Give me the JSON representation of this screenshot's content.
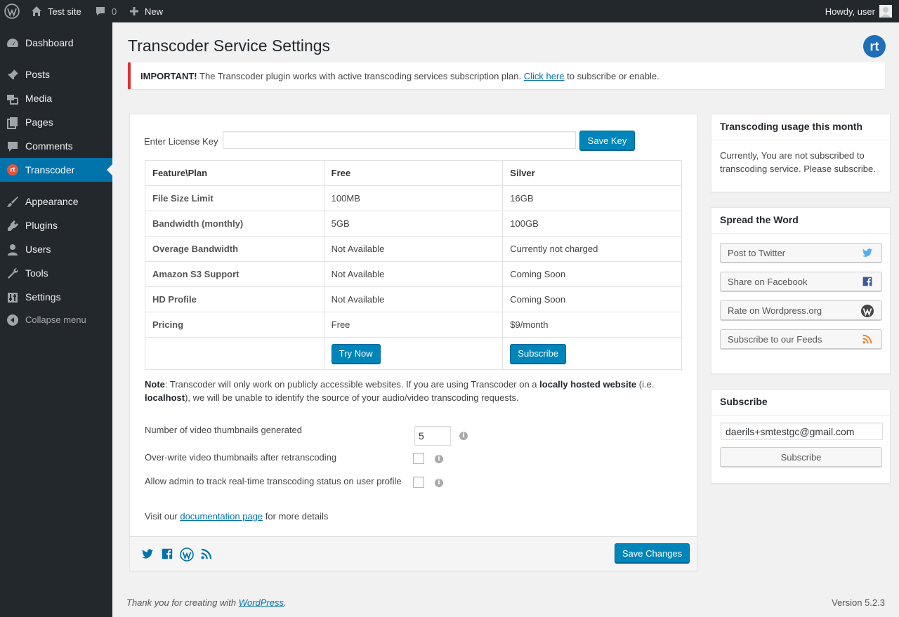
{
  "adminbar": {
    "site_name": "Test site",
    "comments_count": "0",
    "new_label": "New",
    "howdy": "Howdy, user"
  },
  "sidebar": {
    "items": [
      {
        "label": "Dashboard",
        "icon": "dashboard-icon"
      },
      {
        "label": "Posts",
        "icon": "pin-icon"
      },
      {
        "label": "Media",
        "icon": "media-icon"
      },
      {
        "label": "Pages",
        "icon": "pages-icon"
      },
      {
        "label": "Comments",
        "icon": "comment-icon"
      },
      {
        "label": "Transcoder",
        "icon": "rt-icon",
        "current": true
      },
      {
        "label": "Appearance",
        "icon": "brush-icon"
      },
      {
        "label": "Plugins",
        "icon": "plug-icon"
      },
      {
        "label": "Users",
        "icon": "user-icon"
      },
      {
        "label": "Tools",
        "icon": "wrench-icon"
      },
      {
        "label": "Settings",
        "icon": "settings-icon"
      },
      {
        "label": "Collapse menu",
        "icon": "collapse-icon"
      }
    ]
  },
  "page": {
    "title": "Transcoder Service Settings",
    "logo_text": "rt"
  },
  "notice": {
    "strong": "IMPORTANT!",
    "text": " The Transcoder plugin works with active transcoding services subscription plan. ",
    "link": "Click here",
    "after": " to subscribe or enable."
  },
  "license": {
    "label": "Enter License Key",
    "value": "",
    "button": "Save Key"
  },
  "plans": {
    "headers": [
      "Feature\\Plan",
      "Free",
      "Silver"
    ],
    "rows": [
      [
        "File Size Limit",
        "100MB",
        "16GB"
      ],
      [
        "Bandwidth (monthly)",
        "5GB",
        "100GB"
      ],
      [
        "Overage Bandwidth",
        "Not Available",
        "Currently not charged"
      ],
      [
        "Amazon S3 Support",
        "Not Available",
        "Coming Soon"
      ],
      [
        "HD Profile",
        "Not Available",
        "Coming Soon"
      ],
      [
        "Pricing",
        "Free",
        "$9/month"
      ]
    ],
    "try_button": "Try Now",
    "subscribe_button": "Subscribe"
  },
  "note": {
    "label": "Note",
    "t1": ": Transcoder will only work on publicly accessible websites. If you are using Transcoder on a ",
    "b1": "locally hosted website",
    "t2": " (i.e. ",
    "b2": "localhost",
    "t3": "), we will be unable to identify the source of your audio/video transcoding requests."
  },
  "options": {
    "thumbnails_label": "Number of video thumbnails generated",
    "thumbnails_value": "5",
    "overwrite_label": "Over-write video thumbnails after retranscoding",
    "track_label": "Allow admin to track real-time transcoding status on user profile"
  },
  "docs": {
    "before": "Visit our ",
    "link": "documentation page",
    "after": " for more details"
  },
  "footer_actions": {
    "save_button": "Save Changes"
  },
  "usage_widget": {
    "title": "Transcoding usage this month",
    "text": "Currently, You are not subscribed to transcoding service. Please subscribe."
  },
  "spread_widget": {
    "title": "Spread the Word",
    "items": [
      {
        "label": "Post to Twitter",
        "icon": "twitter-icon"
      },
      {
        "label": "Share on Facebook",
        "icon": "facebook-icon"
      },
      {
        "label": "Rate on Wordpress.org",
        "icon": "wordpress-icon"
      },
      {
        "label": "Subscribe to our Feeds",
        "icon": "rss-icon"
      }
    ]
  },
  "subscribe_widget": {
    "title": "Subscribe",
    "email": "daerils+smtestgc@gmail.com",
    "button": "Subscribe"
  },
  "wpfooter": {
    "thanks": "Thank you for creating with ",
    "link": "WordPress",
    "dot": ".",
    "version": "Version 5.2.3"
  },
  "colors": {
    "admin_dark": "#23282d",
    "accent": "#0073aa",
    "primary_button": "#0085ba",
    "notice_error": "#dc3232",
    "rss": "#f0812c"
  }
}
